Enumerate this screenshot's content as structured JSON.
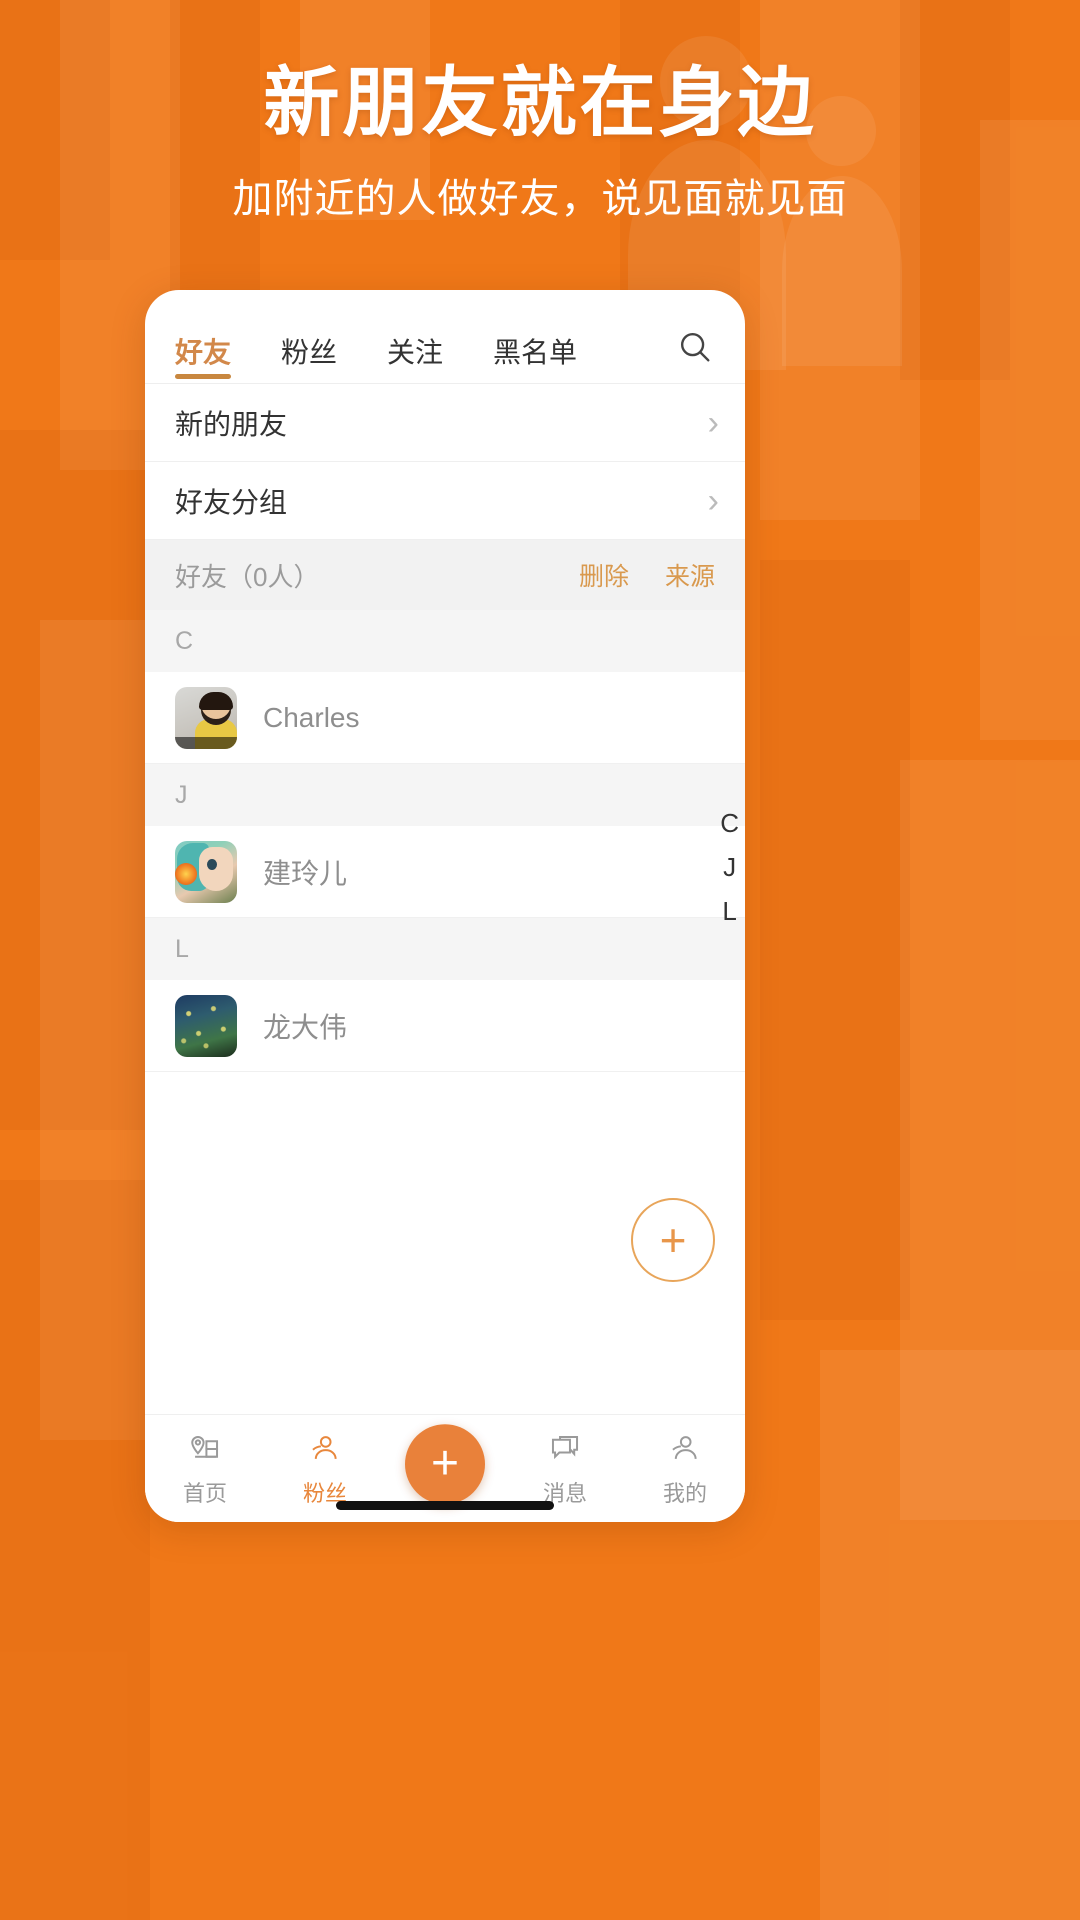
{
  "theme": {
    "background": "#F07818",
    "accent": "#E8873C",
    "tab_active": "#C8873F",
    "action_link": "#D9994E"
  },
  "hero": {
    "title": "新朋友就在身边",
    "subtitle": "加附近的人做好友，说见面就见面"
  },
  "app": {
    "tabs": [
      {
        "label": "好友",
        "active": true
      },
      {
        "label": "粉丝",
        "active": false
      },
      {
        "label": "关注",
        "active": false
      },
      {
        "label": "黑名单",
        "active": false
      }
    ],
    "search_icon": "search-icon",
    "nav_rows": [
      {
        "label": "新的朋友",
        "chevron": "›"
      },
      {
        "label": "好友分组",
        "chevron": "›"
      }
    ],
    "group_header": {
      "title": "好友（0人）",
      "actions": [
        "删除",
        "来源"
      ]
    },
    "sections": [
      {
        "letter": "C",
        "contacts": [
          {
            "name": "Charles",
            "avatar": "av-charles"
          }
        ]
      },
      {
        "letter": "J",
        "contacts": [
          {
            "name": "建玲儿",
            "avatar": "av-jian"
          }
        ]
      },
      {
        "letter": "L",
        "contacts": [
          {
            "name": "龙大伟",
            "avatar": "av-long"
          }
        ]
      }
    ],
    "alpha_index": [
      "C",
      "J",
      "L"
    ],
    "fab": {
      "label": "+"
    },
    "bottom_nav": {
      "center_label": "+",
      "items": [
        {
          "label": "首页",
          "icon": "home-location-icon",
          "active": false
        },
        {
          "label": "粉丝",
          "icon": "fans-person-icon",
          "active": true
        },
        {
          "label": "消息",
          "icon": "message-icon",
          "active": false
        },
        {
          "label": "我的",
          "icon": "profile-icon",
          "active": false
        }
      ]
    }
  }
}
